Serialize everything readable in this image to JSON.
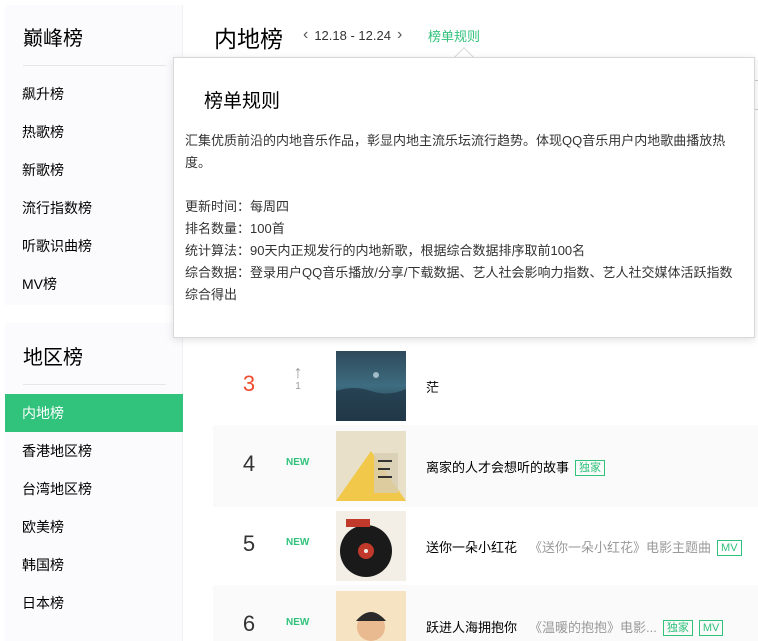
{
  "sidebar": {
    "section1_title": "巅峰榜",
    "section1_items": [
      "飙升榜",
      "热歌榜",
      "新歌榜",
      "流行指数榜",
      "听歌识曲榜",
      "MV榜"
    ],
    "section2_title": "地区榜",
    "section2_items": [
      "内地榜",
      "香港地区榜",
      "台湾地区榜",
      "欧美榜",
      "韩国榜",
      "日本榜"
    ],
    "active_item": "内地榜"
  },
  "header": {
    "title": "内地榜",
    "date_range": "12.18 - 12.24",
    "rules_link": "榜单规则"
  },
  "popup": {
    "title": "榜单规则",
    "description": "汇集优质前沿的内地音乐作品，彰显内地主流乐坛流行趋势。体现QQ音乐用户内地歌曲播放热度。",
    "update_time": "更新时间：每周四",
    "rank_count": "排名数量：100首",
    "algorithm": "统计算法：90天内正规发行的内地新歌，根据综合数据排序取前100名",
    "data_basis": "综合数据：登录用户QQ音乐播放/分享/下载数据、艺人社会影响力指数、艺人社交媒体活跃指数综合得出"
  },
  "songs": [
    {
      "rank": "3",
      "trend": "up",
      "trend_value": "1",
      "name": "茫",
      "album": "",
      "tags": []
    },
    {
      "rank": "4",
      "trend": "NEW",
      "trend_value": "",
      "name": "离家的人才会想听的故事",
      "album": "",
      "tags": [
        "独家"
      ]
    },
    {
      "rank": "5",
      "trend": "NEW",
      "trend_value": "",
      "name": "送你一朵小红花",
      "album": "《送你一朵小红花》电影主题曲",
      "tags": [
        "MV"
      ]
    },
    {
      "rank": "6",
      "trend": "NEW",
      "trend_value": "",
      "name": "跃进人海拥抱你",
      "album": "《温暖的抱抱》电影...",
      "tags": [
        "独家",
        "MV"
      ]
    }
  ],
  "colors": {
    "accent": "#31c27c",
    "top_rank": "#f04c2e"
  }
}
